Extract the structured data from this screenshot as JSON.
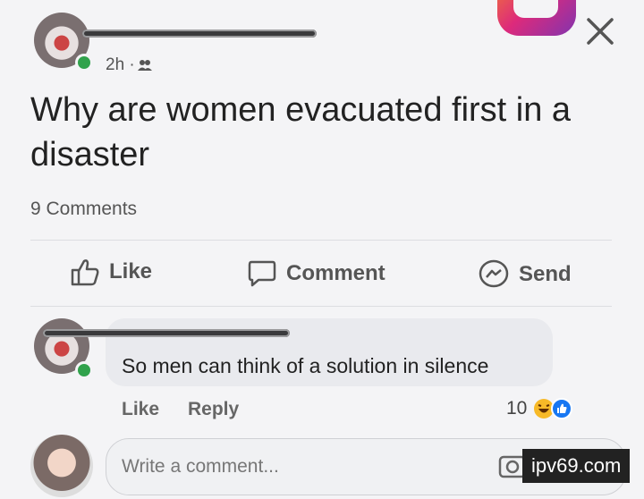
{
  "post": {
    "timestamp": "2h · ",
    "audience_icon": "friends-icon",
    "text": "Why are women evacuated first in a disaster",
    "comments_count": "9 Comments"
  },
  "actions": {
    "like": "Like",
    "comment": "Comment",
    "send": "Send"
  },
  "comment": {
    "text": "So men can think of a solution in silence",
    "like": "Like",
    "reply": "Reply",
    "reaction_count": "10"
  },
  "composer": {
    "placeholder": "Write a comment..."
  },
  "watermark": "ipv69.com",
  "colors": {
    "online": "#31a24c",
    "reaction_like": "#1877f2",
    "reaction_haha": "#f7b928"
  }
}
